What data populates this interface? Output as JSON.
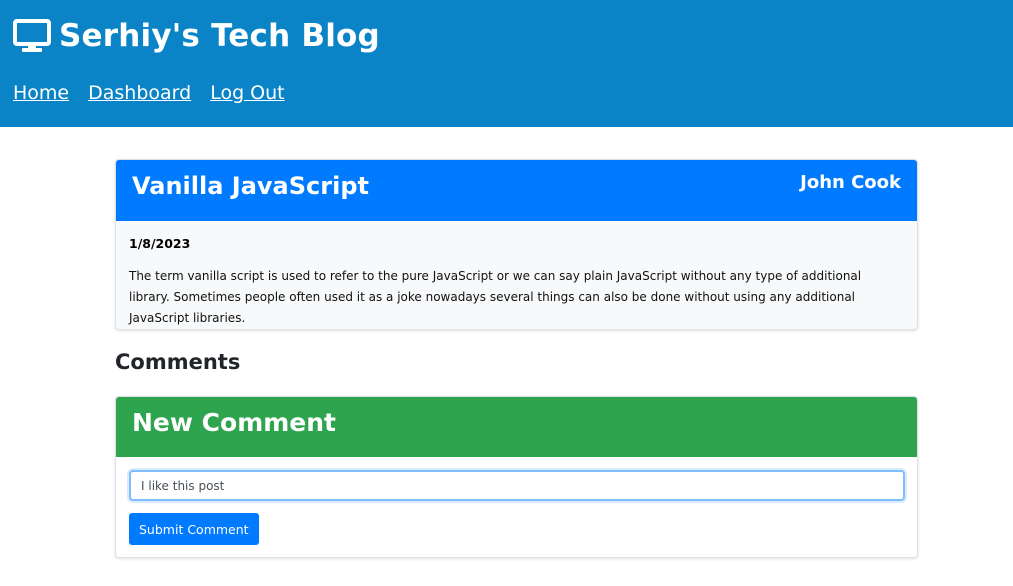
{
  "header": {
    "brand_icon": "monitor-icon",
    "title": "Serhiy's Tech Blog",
    "nav": {
      "home": "Home",
      "dashboard": "Dashboard",
      "logout": "Log Out"
    }
  },
  "post": {
    "title": "Vanilla JavaScript",
    "author": "John Cook",
    "date": "1/8/2023",
    "content": "The term vanilla script is used to refer to the pure JavaScript or we can say plain JavaScript without any type of additional library. Sometimes people often used it as a joke nowadays several things can also be done without using any additional JavaScript libraries."
  },
  "comments": {
    "heading": "Comments",
    "new_comment": {
      "title": "New Comment",
      "input_value": "I like this post",
      "submit_label": "Submit Comment"
    }
  },
  "colors": {
    "header_bg": "#0b84c7",
    "post_header_bg": "#007bff",
    "comment_header_bg": "#2ea44f",
    "button_bg": "#007bff"
  }
}
